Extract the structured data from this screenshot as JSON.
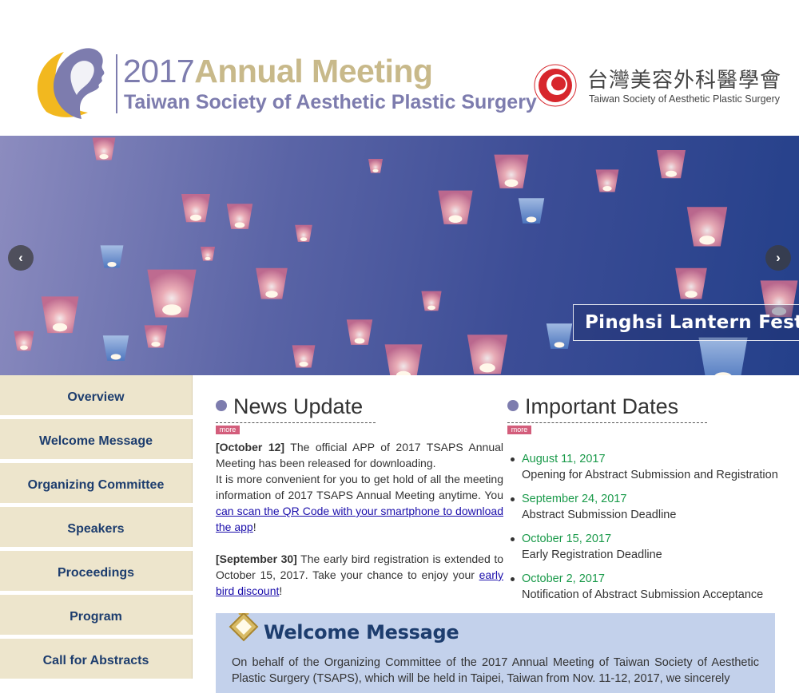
{
  "header": {
    "title_year": "2017",
    "title_meeting": "Annual Meeting",
    "subtitle": "Taiwan Society of Aesthetic Plastic Surgery",
    "society_name_zh": "台灣美容外科醫學會",
    "society_name_en": "Taiwan Society of Aesthetic Plastic Surgery",
    "colors": {
      "brand_purple": "#7d7cae",
      "brand_gold": "#c8b98a",
      "seal_red": "#d7262c"
    }
  },
  "banner": {
    "caption": "Pinghsi Lantern Festival",
    "prev_icon": "chevron-left-icon",
    "next_icon": "chevron-right-icon",
    "prev_glyph": "‹",
    "next_glyph": "›"
  },
  "sidebar": {
    "items": [
      {
        "label": "Overview"
      },
      {
        "label": "Welcome Message"
      },
      {
        "label": "Organizing Committee"
      },
      {
        "label": "Speakers"
      },
      {
        "label": "Proceedings"
      },
      {
        "label": "Program"
      },
      {
        "label": "Call for Abstracts"
      }
    ]
  },
  "news": {
    "title": "News Update",
    "more_label": "more",
    "items": [
      {
        "date": "[October 12]",
        "text1": " The official APP of 2017 TSAPS Annual Meeting has been released for downloading.",
        "text2": "It is more convenient for you to get hold of all the meeting information of 2017 TSAPS Annual Meeting anytime. You ",
        "link": "can scan the QR Code with your smartphone to download the app",
        "tail": "!"
      },
      {
        "date": "[September 30]",
        "text1": " The early bird registration is extended to October 15, 2017. Take your chance to enjoy your ",
        "link": "early bird discount",
        "tail": "!"
      }
    ]
  },
  "dates": {
    "title": "Important Dates",
    "more_label": "more",
    "items": [
      {
        "date": "August 11, 2017",
        "desc": "Opening for Abstract Submission and Registration"
      },
      {
        "date": "September 24, 2017",
        "desc": "Abstract Submission Deadline"
      },
      {
        "date": "October 15, 2017",
        "desc": "Early Registration Deadline"
      },
      {
        "date": "October 2, 2017",
        "desc": "Notification of Abstract Submission Acceptance"
      }
    ]
  },
  "welcome": {
    "title": "Welcome Message",
    "text": "On behalf of the Organizing Committee of the 2017 Annual Meeting of Taiwan Society of Aesthetic Plastic Surgery (TSAPS), which will be held in Taipei, Taiwan from Nov. 11-12, 2017, we sincerely"
  }
}
